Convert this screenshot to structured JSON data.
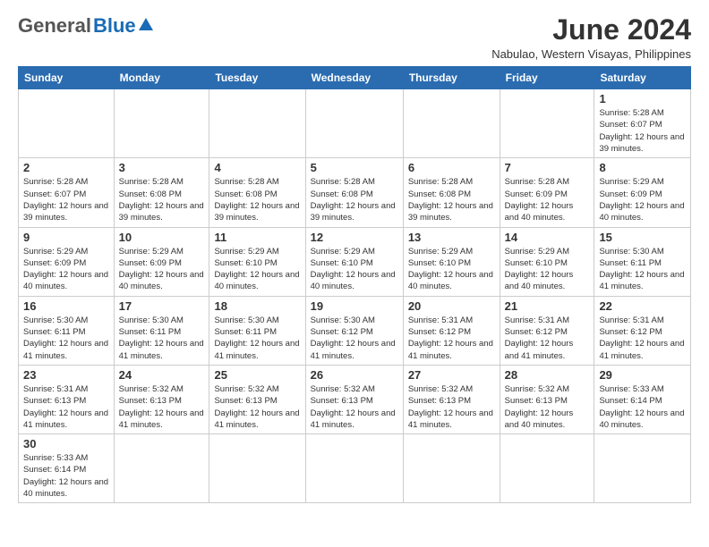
{
  "header": {
    "logo_general": "General",
    "logo_blue": "Blue",
    "month_title": "June 2024",
    "subtitle": "Nabulao, Western Visayas, Philippines"
  },
  "weekdays": [
    "Sunday",
    "Monday",
    "Tuesday",
    "Wednesday",
    "Thursday",
    "Friday",
    "Saturday"
  ],
  "weeks": [
    [
      {
        "day": "",
        "info": ""
      },
      {
        "day": "",
        "info": ""
      },
      {
        "day": "",
        "info": ""
      },
      {
        "day": "",
        "info": ""
      },
      {
        "day": "",
        "info": ""
      },
      {
        "day": "",
        "info": ""
      },
      {
        "day": "1",
        "info": "Sunrise: 5:28 AM\nSunset: 6:07 PM\nDaylight: 12 hours\nand 39 minutes."
      }
    ],
    [
      {
        "day": "2",
        "info": "Sunrise: 5:28 AM\nSunset: 6:07 PM\nDaylight: 12 hours\nand 39 minutes."
      },
      {
        "day": "3",
        "info": "Sunrise: 5:28 AM\nSunset: 6:08 PM\nDaylight: 12 hours\nand 39 minutes."
      },
      {
        "day": "4",
        "info": "Sunrise: 5:28 AM\nSunset: 6:08 PM\nDaylight: 12 hours\nand 39 minutes."
      },
      {
        "day": "5",
        "info": "Sunrise: 5:28 AM\nSunset: 6:08 PM\nDaylight: 12 hours\nand 39 minutes."
      },
      {
        "day": "6",
        "info": "Sunrise: 5:28 AM\nSunset: 6:08 PM\nDaylight: 12 hours\nand 39 minutes."
      },
      {
        "day": "7",
        "info": "Sunrise: 5:28 AM\nSunset: 6:09 PM\nDaylight: 12 hours\nand 40 minutes."
      },
      {
        "day": "8",
        "info": "Sunrise: 5:29 AM\nSunset: 6:09 PM\nDaylight: 12 hours\nand 40 minutes."
      }
    ],
    [
      {
        "day": "9",
        "info": "Sunrise: 5:29 AM\nSunset: 6:09 PM\nDaylight: 12 hours\nand 40 minutes."
      },
      {
        "day": "10",
        "info": "Sunrise: 5:29 AM\nSunset: 6:09 PM\nDaylight: 12 hours\nand 40 minutes."
      },
      {
        "day": "11",
        "info": "Sunrise: 5:29 AM\nSunset: 6:10 PM\nDaylight: 12 hours\nand 40 minutes."
      },
      {
        "day": "12",
        "info": "Sunrise: 5:29 AM\nSunset: 6:10 PM\nDaylight: 12 hours\nand 40 minutes."
      },
      {
        "day": "13",
        "info": "Sunrise: 5:29 AM\nSunset: 6:10 PM\nDaylight: 12 hours\nand 40 minutes."
      },
      {
        "day": "14",
        "info": "Sunrise: 5:29 AM\nSunset: 6:10 PM\nDaylight: 12 hours\nand 40 minutes."
      },
      {
        "day": "15",
        "info": "Sunrise: 5:30 AM\nSunset: 6:11 PM\nDaylight: 12 hours\nand 41 minutes."
      }
    ],
    [
      {
        "day": "16",
        "info": "Sunrise: 5:30 AM\nSunset: 6:11 PM\nDaylight: 12 hours\nand 41 minutes."
      },
      {
        "day": "17",
        "info": "Sunrise: 5:30 AM\nSunset: 6:11 PM\nDaylight: 12 hours\nand 41 minutes."
      },
      {
        "day": "18",
        "info": "Sunrise: 5:30 AM\nSunset: 6:11 PM\nDaylight: 12 hours\nand 41 minutes."
      },
      {
        "day": "19",
        "info": "Sunrise: 5:30 AM\nSunset: 6:12 PM\nDaylight: 12 hours\nand 41 minutes."
      },
      {
        "day": "20",
        "info": "Sunrise: 5:31 AM\nSunset: 6:12 PM\nDaylight: 12 hours\nand 41 minutes."
      },
      {
        "day": "21",
        "info": "Sunrise: 5:31 AM\nSunset: 6:12 PM\nDaylight: 12 hours\nand 41 minutes."
      },
      {
        "day": "22",
        "info": "Sunrise: 5:31 AM\nSunset: 6:12 PM\nDaylight: 12 hours\nand 41 minutes."
      }
    ],
    [
      {
        "day": "23",
        "info": "Sunrise: 5:31 AM\nSunset: 6:13 PM\nDaylight: 12 hours\nand 41 minutes."
      },
      {
        "day": "24",
        "info": "Sunrise: 5:32 AM\nSunset: 6:13 PM\nDaylight: 12 hours\nand 41 minutes."
      },
      {
        "day": "25",
        "info": "Sunrise: 5:32 AM\nSunset: 6:13 PM\nDaylight: 12 hours\nand 41 minutes."
      },
      {
        "day": "26",
        "info": "Sunrise: 5:32 AM\nSunset: 6:13 PM\nDaylight: 12 hours\nand 41 minutes."
      },
      {
        "day": "27",
        "info": "Sunrise: 5:32 AM\nSunset: 6:13 PM\nDaylight: 12 hours\nand 41 minutes."
      },
      {
        "day": "28",
        "info": "Sunrise: 5:32 AM\nSunset: 6:13 PM\nDaylight: 12 hours\nand 40 minutes."
      },
      {
        "day": "29",
        "info": "Sunrise: 5:33 AM\nSunset: 6:14 PM\nDaylight: 12 hours\nand 40 minutes."
      }
    ],
    [
      {
        "day": "30",
        "info": "Sunrise: 5:33 AM\nSunset: 6:14 PM\nDaylight: 12 hours\nand 40 minutes."
      },
      {
        "day": "",
        "info": ""
      },
      {
        "day": "",
        "info": ""
      },
      {
        "day": "",
        "info": ""
      },
      {
        "day": "",
        "info": ""
      },
      {
        "day": "",
        "info": ""
      },
      {
        "day": "",
        "info": ""
      }
    ]
  ]
}
